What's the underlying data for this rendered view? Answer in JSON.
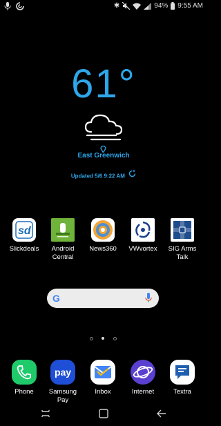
{
  "status_bar": {
    "battery": "94%",
    "time": "9:55 AM"
  },
  "weather": {
    "temperature": "61°",
    "location": "East Greenwich",
    "updated": "Updated 5/6 9:22 AM"
  },
  "apps": [
    {
      "label": "Slickdeals",
      "icon": "slickdeals-icon"
    },
    {
      "label": "Android Central",
      "icon": "android-central-icon"
    },
    {
      "label": "News360",
      "icon": "news360-icon"
    },
    {
      "label": "VWvortex",
      "icon": "vwvortex-icon"
    },
    {
      "label": "SIG Arms Talk",
      "icon": "sig-arms-talk-icon"
    }
  ],
  "search": {
    "logo": "G"
  },
  "page_indicator": {
    "pages": 3,
    "current": 2
  },
  "dock": [
    {
      "label": "Phone",
      "icon": "phone-icon"
    },
    {
      "label": "Samsung Pay",
      "icon": "samsung-pay-icon",
      "icon_text": "pay"
    },
    {
      "label": "Inbox",
      "icon": "inbox-icon"
    },
    {
      "label": "Internet",
      "icon": "internet-icon"
    },
    {
      "label": "Textra",
      "icon": "textra-icon"
    }
  ],
  "colors": {
    "accent": "#2ea6ea",
    "phone": "#1fca6b",
    "samsung_pay": "#1f4fd6",
    "internet": "#5b3fd0"
  }
}
